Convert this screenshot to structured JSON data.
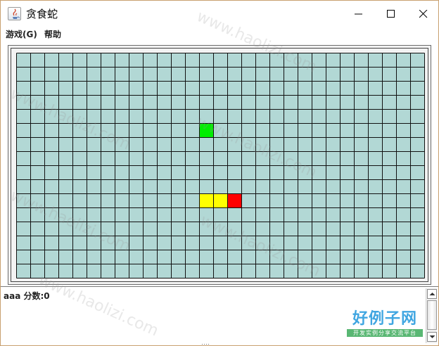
{
  "window": {
    "title": "贪食蛇"
  },
  "menu": {
    "game": "游戏(G)",
    "help": "帮助"
  },
  "board": {
    "columns": 29,
    "rows": 16,
    "cell_color": "#b2d8d5",
    "line_color": "#111111",
    "food": {
      "col": 13,
      "row": 5,
      "color": "#00ee00"
    },
    "snake": {
      "head": {
        "col": 15,
        "row": 10,
        "color": "#ff0000"
      },
      "body": [
        {
          "col": 13,
          "row": 10
        },
        {
          "col": 14,
          "row": 10
        }
      ],
      "body_color": "#ffff00"
    }
  },
  "console": {
    "score_text": "aaa 分数:0"
  },
  "watermark": {
    "text": "www.haolizi.com",
    "brand": "好例子网",
    "brand_sub": "开发实例分享交流平台"
  }
}
